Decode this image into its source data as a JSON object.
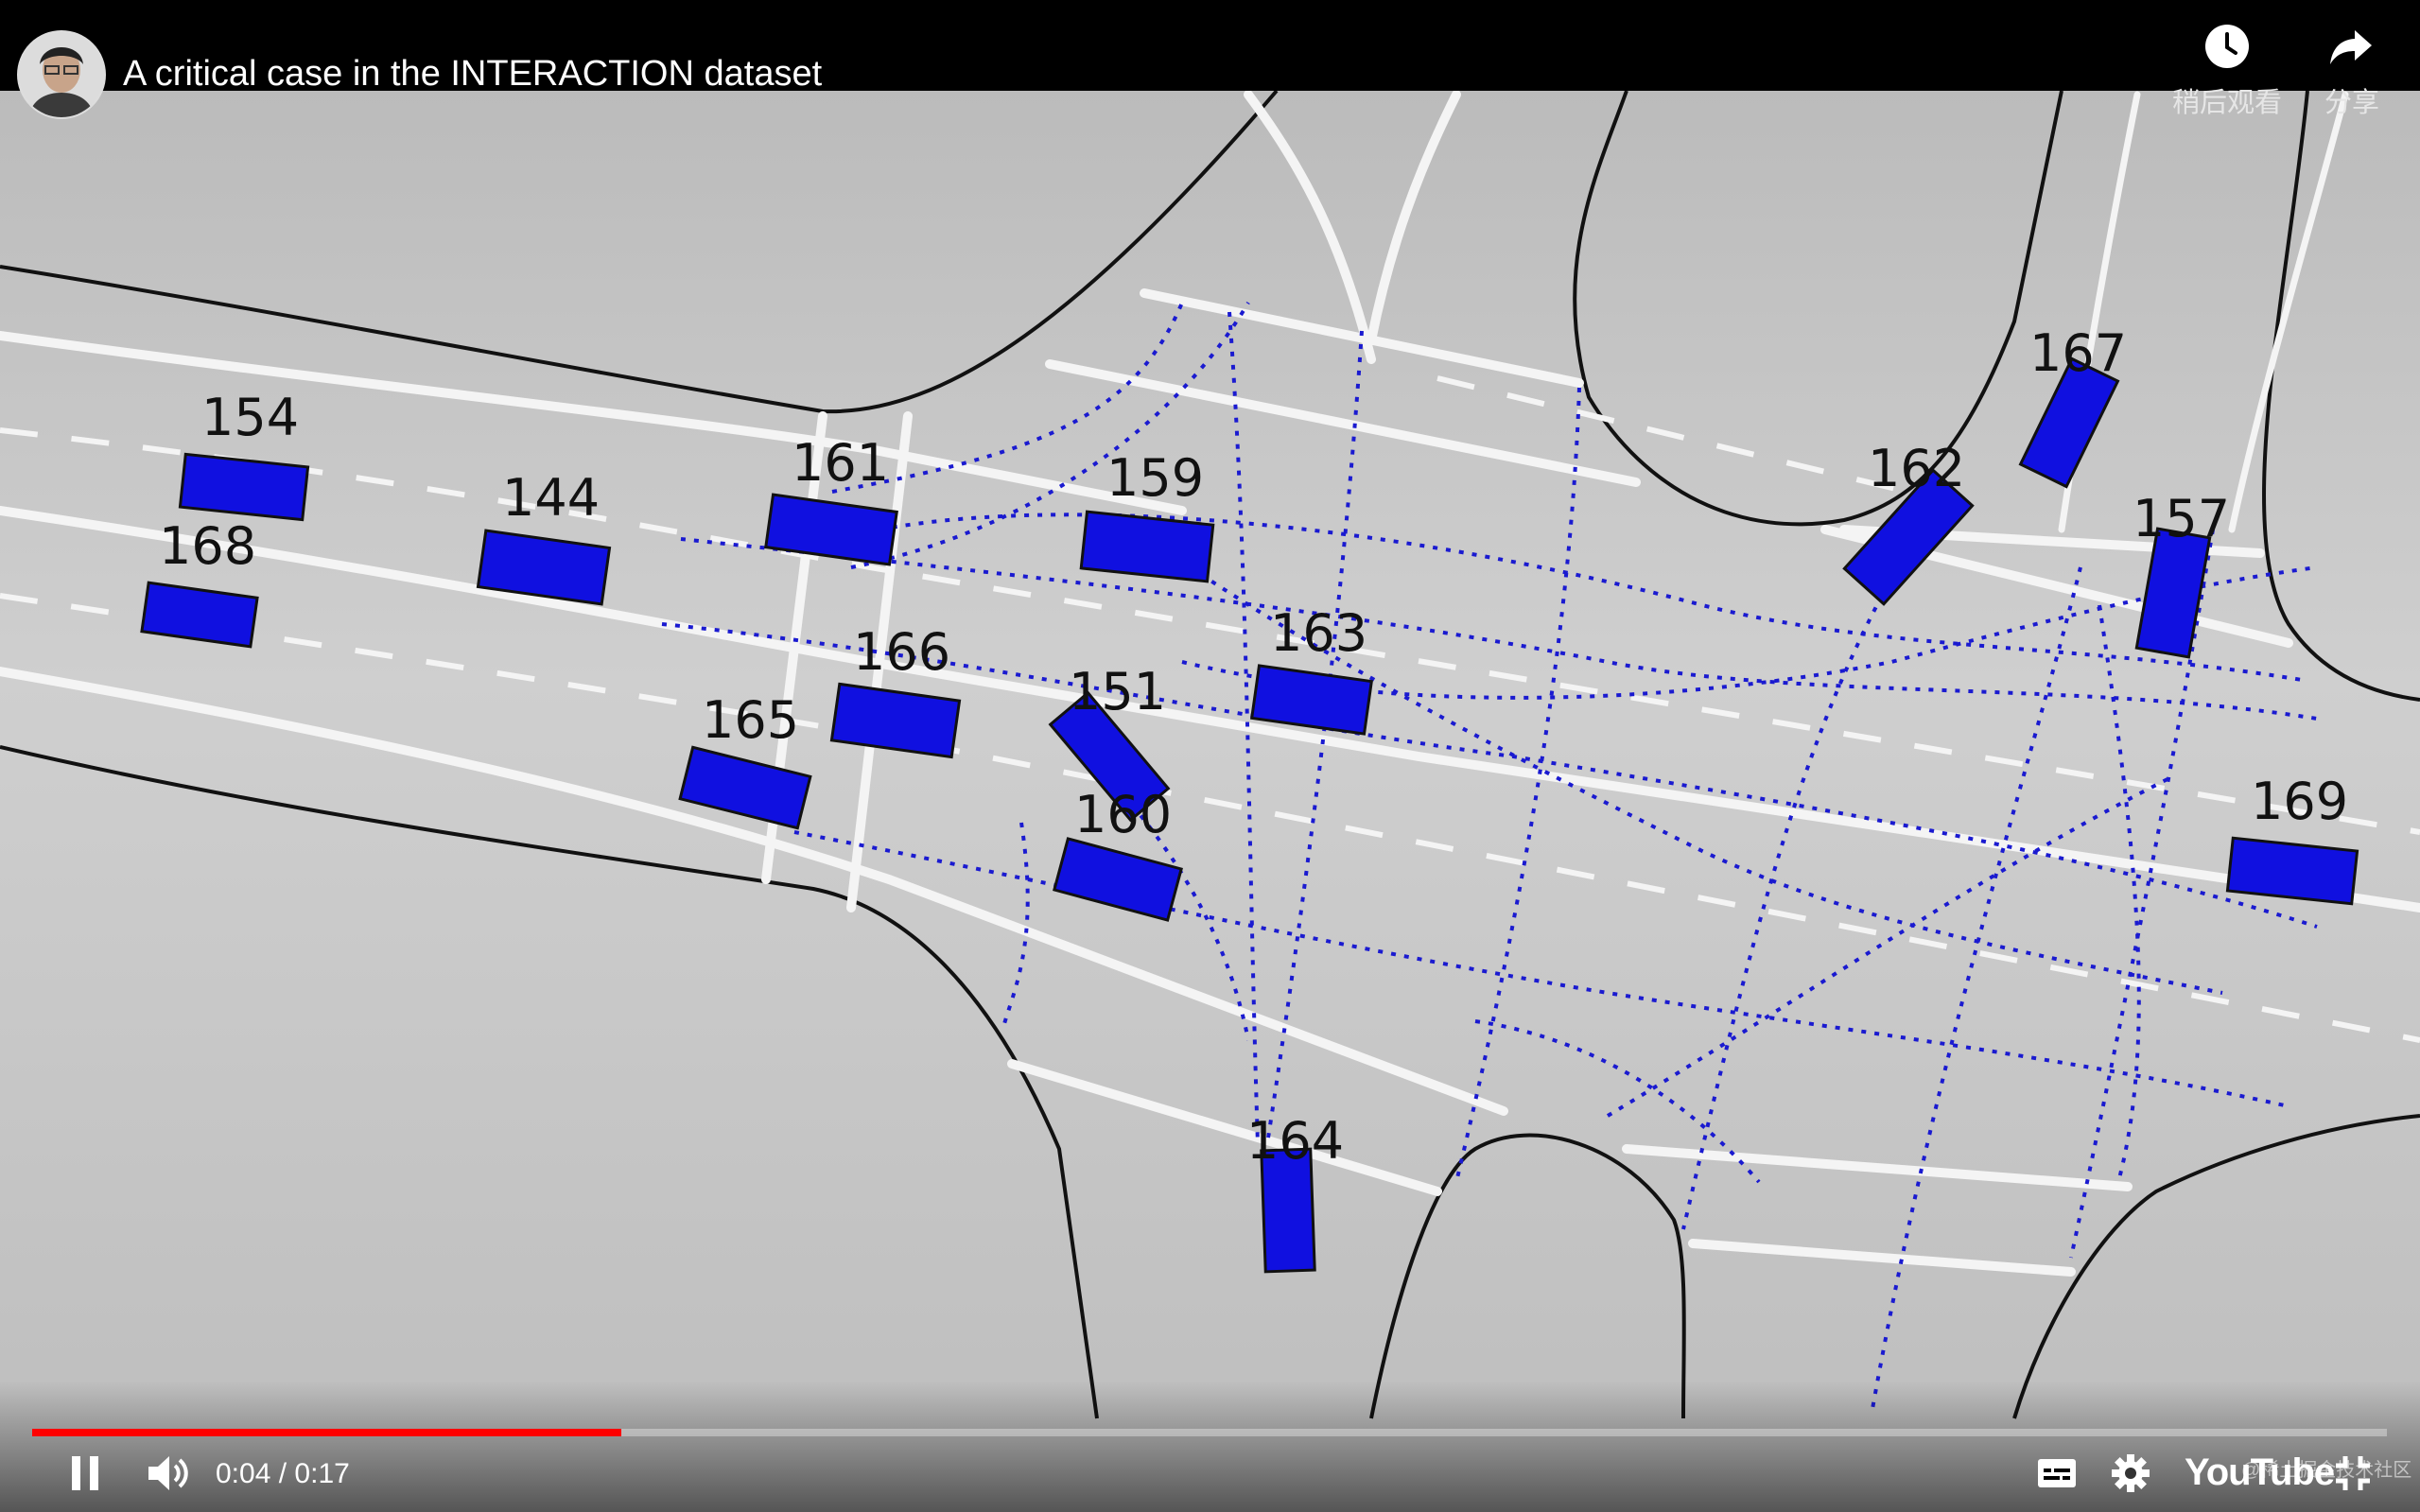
{
  "video": {
    "title": "A critical case in the INTERACTION dataset",
    "watch_later_label": "稍后观看",
    "share_label": "分享",
    "current_time": "0:04",
    "separator": "/",
    "duration": "0:17",
    "progress_fraction": 0.25,
    "watermark": "@稀土掘金技术社区",
    "logo_text": "YouTube",
    "accent_color": "#ff0000"
  },
  "vehicles": [
    {
      "id": "154"
    },
    {
      "id": "168"
    },
    {
      "id": "144"
    },
    {
      "id": "161"
    },
    {
      "id": "159"
    },
    {
      "id": "166"
    },
    {
      "id": "165"
    },
    {
      "id": "151"
    },
    {
      "id": "160"
    },
    {
      "id": "163"
    },
    {
      "id": "164"
    },
    {
      "id": "162"
    },
    {
      "id": "167"
    },
    {
      "id": "157"
    },
    {
      "id": "169"
    }
  ],
  "icons": {
    "avatar": "avatar-icon",
    "watch_later": "clock-icon",
    "share": "share-icon",
    "play_pause": "pause-icon",
    "volume": "volume-icon",
    "subtitles": "subtitles-icon",
    "settings": "gear-icon",
    "fullscreen": "exit-fullscreen-icon"
  },
  "colors": {
    "vehicle_fill": "#1010e0",
    "trajectory": "#1a1ad0",
    "road": "#c8c8c8"
  }
}
